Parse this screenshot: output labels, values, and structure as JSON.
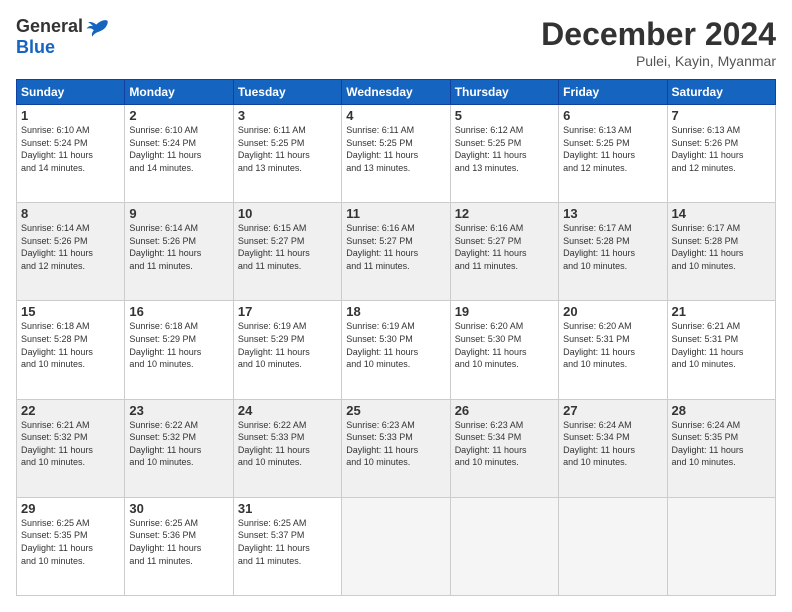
{
  "logo": {
    "general": "General",
    "blue": "Blue"
  },
  "header": {
    "month": "December 2024",
    "location": "Pulei, Kayin, Myanmar"
  },
  "weekdays": [
    "Sunday",
    "Monday",
    "Tuesday",
    "Wednesday",
    "Thursday",
    "Friday",
    "Saturday"
  ],
  "weeks": [
    [
      {
        "day": "1",
        "sunrise": "6:10 AM",
        "sunset": "5:24 PM",
        "daylight": "11 hours and 14 minutes."
      },
      {
        "day": "2",
        "sunrise": "6:10 AM",
        "sunset": "5:24 PM",
        "daylight": "11 hours and 14 minutes."
      },
      {
        "day": "3",
        "sunrise": "6:11 AM",
        "sunset": "5:25 PM",
        "daylight": "11 hours and 13 minutes."
      },
      {
        "day": "4",
        "sunrise": "6:11 AM",
        "sunset": "5:25 PM",
        "daylight": "11 hours and 13 minutes."
      },
      {
        "day": "5",
        "sunrise": "6:12 AM",
        "sunset": "5:25 PM",
        "daylight": "11 hours and 13 minutes."
      },
      {
        "day": "6",
        "sunrise": "6:13 AM",
        "sunset": "5:25 PM",
        "daylight": "11 hours and 12 minutes."
      },
      {
        "day": "7",
        "sunrise": "6:13 AM",
        "sunset": "5:26 PM",
        "daylight": "11 hours and 12 minutes."
      }
    ],
    [
      {
        "day": "8",
        "sunrise": "6:14 AM",
        "sunset": "5:26 PM",
        "daylight": "11 hours and 12 minutes."
      },
      {
        "day": "9",
        "sunrise": "6:14 AM",
        "sunset": "5:26 PM",
        "daylight": "11 hours and 11 minutes."
      },
      {
        "day": "10",
        "sunrise": "6:15 AM",
        "sunset": "5:27 PM",
        "daylight": "11 hours and 11 minutes."
      },
      {
        "day": "11",
        "sunrise": "6:16 AM",
        "sunset": "5:27 PM",
        "daylight": "11 hours and 11 minutes."
      },
      {
        "day": "12",
        "sunrise": "6:16 AM",
        "sunset": "5:27 PM",
        "daylight": "11 hours and 11 minutes."
      },
      {
        "day": "13",
        "sunrise": "6:17 AM",
        "sunset": "5:28 PM",
        "daylight": "11 hours and 10 minutes."
      },
      {
        "day": "14",
        "sunrise": "6:17 AM",
        "sunset": "5:28 PM",
        "daylight": "11 hours and 10 minutes."
      }
    ],
    [
      {
        "day": "15",
        "sunrise": "6:18 AM",
        "sunset": "5:28 PM",
        "daylight": "11 hours and 10 minutes."
      },
      {
        "day": "16",
        "sunrise": "6:18 AM",
        "sunset": "5:29 PM",
        "daylight": "11 hours and 10 minutes."
      },
      {
        "day": "17",
        "sunrise": "6:19 AM",
        "sunset": "5:29 PM",
        "daylight": "11 hours and 10 minutes."
      },
      {
        "day": "18",
        "sunrise": "6:19 AM",
        "sunset": "5:30 PM",
        "daylight": "11 hours and 10 minutes."
      },
      {
        "day": "19",
        "sunrise": "6:20 AM",
        "sunset": "5:30 PM",
        "daylight": "11 hours and 10 minutes."
      },
      {
        "day": "20",
        "sunrise": "6:20 AM",
        "sunset": "5:31 PM",
        "daylight": "11 hours and 10 minutes."
      },
      {
        "day": "21",
        "sunrise": "6:21 AM",
        "sunset": "5:31 PM",
        "daylight": "11 hours and 10 minutes."
      }
    ],
    [
      {
        "day": "22",
        "sunrise": "6:21 AM",
        "sunset": "5:32 PM",
        "daylight": "11 hours and 10 minutes."
      },
      {
        "day": "23",
        "sunrise": "6:22 AM",
        "sunset": "5:32 PM",
        "daylight": "11 hours and 10 minutes."
      },
      {
        "day": "24",
        "sunrise": "6:22 AM",
        "sunset": "5:33 PM",
        "daylight": "11 hours and 10 minutes."
      },
      {
        "day": "25",
        "sunrise": "6:23 AM",
        "sunset": "5:33 PM",
        "daylight": "11 hours and 10 minutes."
      },
      {
        "day": "26",
        "sunrise": "6:23 AM",
        "sunset": "5:34 PM",
        "daylight": "11 hours and 10 minutes."
      },
      {
        "day": "27",
        "sunrise": "6:24 AM",
        "sunset": "5:34 PM",
        "daylight": "11 hours and 10 minutes."
      },
      {
        "day": "28",
        "sunrise": "6:24 AM",
        "sunset": "5:35 PM",
        "daylight": "11 hours and 10 minutes."
      }
    ],
    [
      {
        "day": "29",
        "sunrise": "6:25 AM",
        "sunset": "5:35 PM",
        "daylight": "11 hours and 10 minutes."
      },
      {
        "day": "30",
        "sunrise": "6:25 AM",
        "sunset": "5:36 PM",
        "daylight": "11 hours and 11 minutes."
      },
      {
        "day": "31",
        "sunrise": "6:25 AM",
        "sunset": "5:37 PM",
        "daylight": "11 hours and 11 minutes."
      },
      null,
      null,
      null,
      null
    ]
  ],
  "labels": {
    "sunrise": "Sunrise:",
    "sunset": "Sunset:",
    "daylight": "Daylight:"
  }
}
